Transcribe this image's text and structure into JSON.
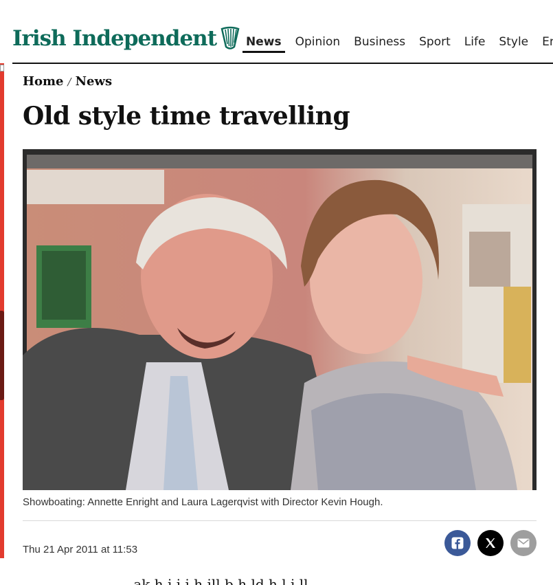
{
  "brand": {
    "name": "Irish Independent",
    "logo_color": "#0e6b5a"
  },
  "nav": {
    "items": [
      {
        "label": "News",
        "active": true
      },
      {
        "label": "Opinion",
        "active": false
      },
      {
        "label": "Business",
        "active": false
      },
      {
        "label": "Sport",
        "active": false
      },
      {
        "label": "Life",
        "active": false
      },
      {
        "label": "Style",
        "active": false
      },
      {
        "label": "Ente",
        "active": false
      }
    ]
  },
  "breadcrumb": {
    "home": "Home",
    "separator": "/",
    "section": "News"
  },
  "article": {
    "title": "Old style time travelling",
    "caption": "Showboating: Annette Enright and Laura Lagerqvist with Director Kevin Hough.",
    "dateline": "Thu 21 Apr 2011 at 11:53",
    "body_peek": "… ak  h  i   i    i   h    ill b    h ld  h  l    i    ll"
  },
  "share": {
    "facebook_icon": "facebook-icon",
    "x_icon": "x-icon",
    "email_icon": "email-icon",
    "colors": {
      "facebook": "#3b5998",
      "x": "#000000",
      "email": "#9e9e9e"
    }
  },
  "ad_rail": {
    "color": "#e23b2e"
  }
}
